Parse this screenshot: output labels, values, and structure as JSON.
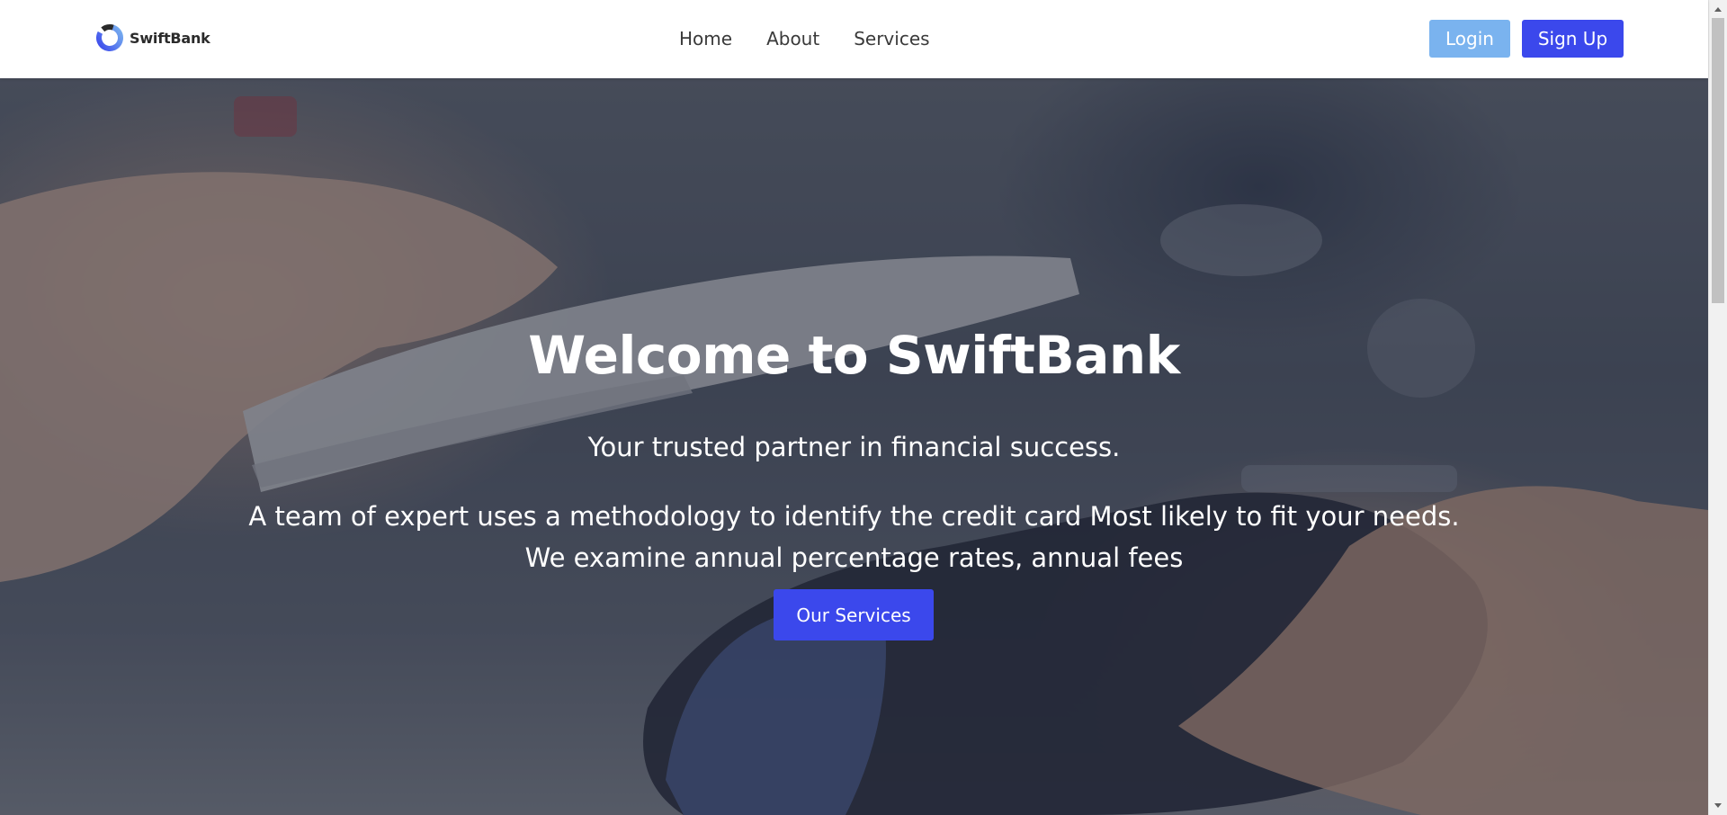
{
  "header": {
    "brand_name": "SwiftBank",
    "nav": [
      {
        "label": "Home"
      },
      {
        "label": "About"
      },
      {
        "label": "Services"
      }
    ],
    "login_label": "Login",
    "signup_label": "Sign Up"
  },
  "hero": {
    "title": "Welcome to SwiftBank",
    "subtitle": "Your trusted partner in financial success.",
    "description_line1": "A team of expert uses a methodology to identify the credit card Most likely to fit your needs.",
    "description_line2": "We examine annual percentage rates, annual fees",
    "cta_label": "Our Services"
  },
  "colors": {
    "primary": "#3b48ec",
    "login_button": "#7ab3ef",
    "hero_text": "#ffffff",
    "nav_text": "#3a3a3a"
  },
  "icons": {
    "logo": "swiftbank-logo-icon",
    "scroll_up": "chevron-up-icon",
    "scroll_down": "chevron-down-icon"
  }
}
